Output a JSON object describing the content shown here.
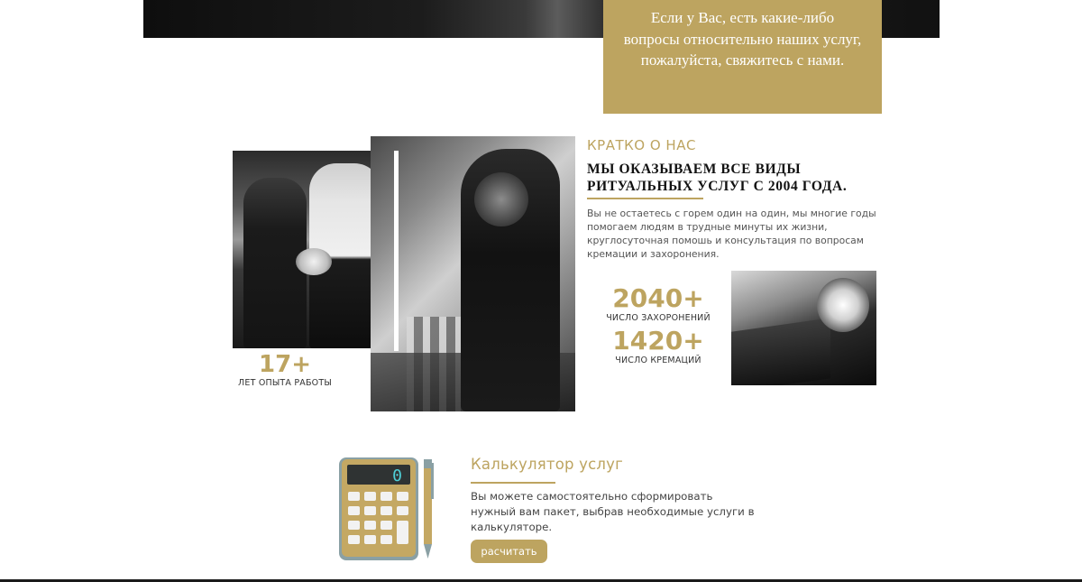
{
  "contact_box": {
    "text": "Если у Вас, есть какие-либо вопросы относительно наших услуг, пожалуйста, свяжитесь с нами."
  },
  "about": {
    "kicker": "КРАТКО О НАС",
    "heading": "МЫ ОКАЗЫВАЕМ ВСЕ ВИДЫ РИТУАЛЬНЫХ УСЛУГ С 2004 ГОДА.",
    "text": "Вы не остаетесь с горем один на один, мы многие годы помогаем людям в трудные минуты их жизни, круглосуточная помошь и консультация по вопросам кремации и захоронения.",
    "experience": {
      "value": "17+",
      "label": "ЛЕТ ОПЫТА РАБОТЫ"
    },
    "stats": [
      {
        "value": "2040+",
        "label": "ЧИСЛО ЗАХОРОНЕНИЙ"
      },
      {
        "value": "1420+",
        "label": "ЧИСЛО КРЕМАЦИЙ"
      }
    ]
  },
  "calculator": {
    "title": "Калькулятор услуг",
    "text": "Вы можете самостоятельно сформировать нужный вам пакет, выбрав необходимые услуги в калькуляторе.",
    "button_label": "расчитать",
    "display_value": "0"
  },
  "colors": {
    "accent": "#bda460",
    "heading": "#111111",
    "body_text": "#555555"
  }
}
